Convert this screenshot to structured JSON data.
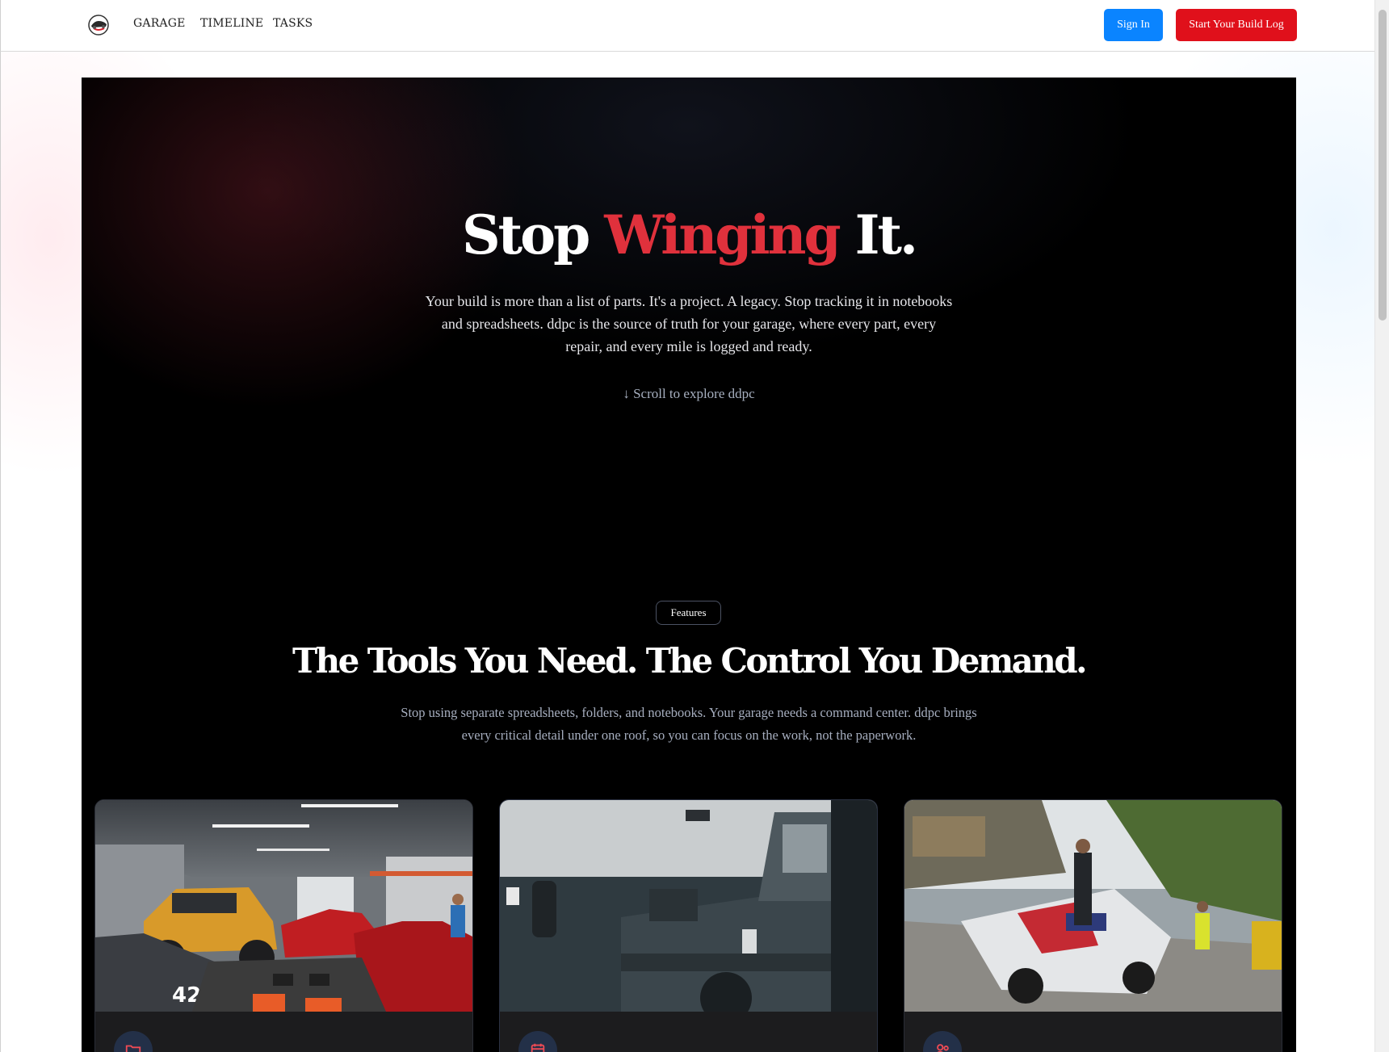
{
  "nav": {
    "links": [
      "GARAGE",
      "TIMELINE",
      "TASKS"
    ],
    "signin_label": "Sign In",
    "start_label": "Start Your Build Log"
  },
  "hero": {
    "title_pre": "Stop ",
    "title_accent": "Winging",
    "title_post": " It.",
    "subtitle": "Your build is more than a list of parts. It's a project. A legacy. Stop tracking it in notebooks and spreadsheets. ddpc is the source of truth for your garage, where every part, every repair, and every mile is logged and ready.",
    "scroll_cta": "↓ Scroll to explore ddpc"
  },
  "features": {
    "badge": "Features",
    "title": "The Tools You Need. The Control You Demand.",
    "subtitle": "Stop using separate spreadsheets, folders, and notebooks. Your garage needs a command center. ddpc brings every critical detail under one roof, so you can focus on the work, not the paperwork.",
    "cards": [
      {
        "image": "garage-photo",
        "icon": "folder-icon"
      },
      {
        "image": "workshop-truck-photo",
        "icon": "calendar-icon"
      },
      {
        "image": "race-pit-photo",
        "icon": "users-icon"
      }
    ]
  },
  "colors": {
    "accent_red": "#e0313c",
    "signin_blue": "#0a84ff",
    "start_red": "#e0101b",
    "hero_bg": "#000000"
  }
}
